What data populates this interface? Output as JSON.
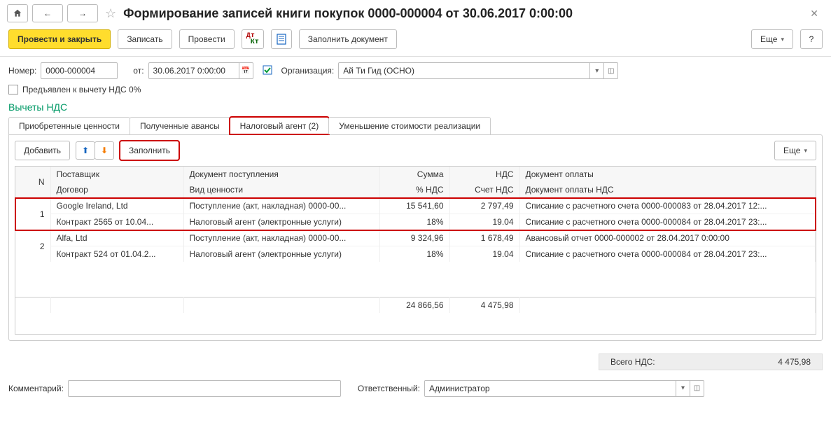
{
  "header": {
    "title": "Формирование записей книги покупок 0000-000004 от 30.06.2017 0:00:00"
  },
  "cmdbar": {
    "post_close": "Провести и закрыть",
    "save": "Записать",
    "post": "Провести",
    "fill_doc": "Заполнить документ",
    "more": "Еще"
  },
  "form": {
    "number_label": "Номер:",
    "number_value": "0000-000004",
    "date_label": "от:",
    "date_value": "30.06.2017  0:00:00",
    "org_label": "Организация:",
    "org_value": "Ай Ти Гид (ОСНО)",
    "vat0_label": "Предъявлен к вычету НДС 0%"
  },
  "section": {
    "title": "Вычеты НДС"
  },
  "tabs": {
    "t1": "Приобретенные ценности",
    "t2": "Полученные авансы",
    "t3": "Налоговый агент (2)",
    "t4": "Уменьшение стоимости реализации"
  },
  "subtoolbar": {
    "add": "Добавить",
    "fill": "Заполнить",
    "more": "Еще"
  },
  "columns": {
    "n": "N",
    "supplier": "Поставщик",
    "contract": "Договор",
    "indoc": "Документ поступления",
    "valtype": "Вид ценности",
    "sum": "Сумма",
    "pct": "% НДС",
    "nds": "НДС",
    "acct": "Счет НДС",
    "paydoc": "Документ оплаты",
    "payndsdoc": "Документ оплаты НДС"
  },
  "rows": [
    {
      "n": "1",
      "supplier": "Google Ireland, Ltd",
      "contract": "Контракт 2565 от 10.04...",
      "indoc": "Поступление (акт, накладная) 0000-00...",
      "valtype": "Налоговый агент (электронные услуги)",
      "sum": "15 541,60",
      "pct": "18%",
      "nds": "2 797,49",
      "acct": "19.04",
      "paydoc": "Списание с расчетного счета 0000-000083 от 28.04.2017 12:...",
      "payndsdoc": "Списание с расчетного счета 0000-000084 от 28.04.2017 23:..."
    },
    {
      "n": "2",
      "supplier": "Alfa, Ltd",
      "contract": "Контракт 524 от 01.04.2...",
      "indoc": "Поступление (акт, накладная) 0000-00...",
      "valtype": "Налоговый агент (электронные услуги)",
      "sum": "9 324,96",
      "pct": "18%",
      "nds": "1 678,49",
      "acct": "19.04",
      "paydoc": "Авансовый отчет 0000-000002 от 28.04.2017 0:00:00",
      "payndsdoc": "Списание с расчетного счета 0000-000084 от 28.04.2017 23:..."
    }
  ],
  "totals_row": {
    "sum": "24 866,56",
    "nds": "4 475,98"
  },
  "footer_totals": {
    "label": "Всего НДС:",
    "value": "4 475,98"
  },
  "bottom": {
    "comment_label": "Комментарий:",
    "comment_value": "",
    "resp_label": "Ответственный:",
    "resp_value": "Администратор"
  }
}
